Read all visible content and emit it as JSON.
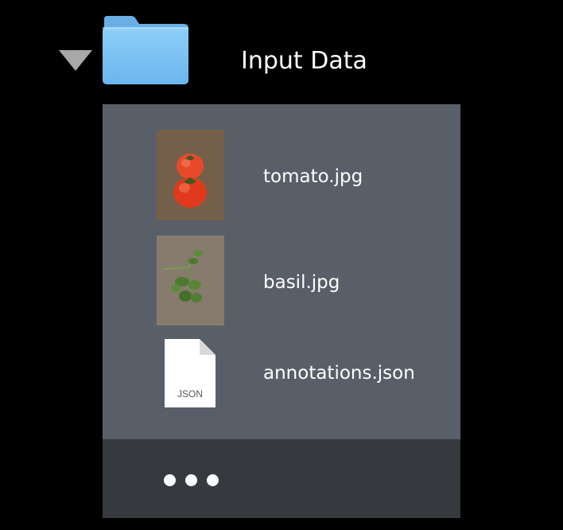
{
  "folder": {
    "title": "Input Data",
    "icon": "folder-icon",
    "expanded": true,
    "color": "#7cc3f3"
  },
  "files": [
    {
      "name": "tomato.jpg",
      "icon": "image-thumbnail-tomato"
    },
    {
      "name": "basil.jpg",
      "icon": "image-thumbnail-basil"
    },
    {
      "name": "annotations.json",
      "icon": "json-document-icon",
      "icon_label": "JSON"
    }
  ],
  "more": {
    "icon": "ellipsis-icon"
  },
  "colors": {
    "background": "#000000",
    "panel": "#585f69",
    "footer": "#363a3f",
    "text": "#ffffff",
    "triangle": "#a8a8a8"
  }
}
